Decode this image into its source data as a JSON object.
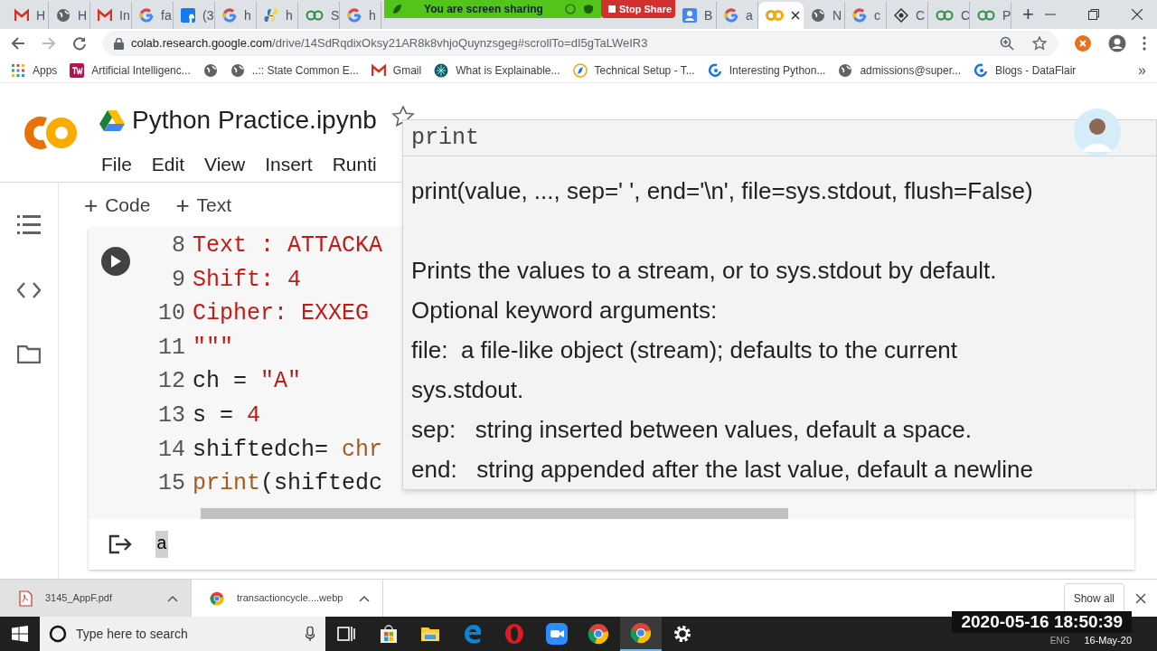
{
  "browser": {
    "tabs_left": [
      {
        "kind": "mail",
        "label": "H",
        "selected": false
      },
      {
        "kind": "globe",
        "label": "H",
        "selected": false
      },
      {
        "kind": "mail",
        "label": "In",
        "selected": false
      },
      {
        "kind": "ring",
        "label": "fa",
        "selected": false
      },
      {
        "kind": "square",
        "label": "(3",
        "selected": false
      },
      {
        "kind": "ring",
        "label": "h",
        "selected": false
      },
      {
        "kind": "twotone",
        "label": "h",
        "selected": false
      },
      {
        "kind": "double",
        "label": "S",
        "selected": false
      },
      {
        "kind": "ring",
        "label": "h",
        "selected": false
      }
    ],
    "sharing_banner": "You are screen sharing",
    "stop_share": "Stop Share",
    "tabs_right": [
      {
        "kind": "person",
        "label": "B",
        "selected": false
      },
      {
        "kind": "ring",
        "label": "a",
        "selected": false
      },
      {
        "kind": "colab",
        "selected": true
      },
      {
        "kind": "globe",
        "label": "N",
        "selected": false
      },
      {
        "kind": "ring",
        "label": "c",
        "selected": false
      },
      {
        "kind": "diamond",
        "label": "C",
        "selected": false
      },
      {
        "kind": "double",
        "label": "C",
        "selected": false
      },
      {
        "kind": "double",
        "label": "P",
        "selected": false
      }
    ],
    "new_tab": "+",
    "url_domain": "colab.research.google.com",
    "url_path": "/drive/14SdRqdixOksy21AR8k8vhjoQuynzsgeg#scrollTo=dI5gTaLWeIR3",
    "bookmarks": [
      {
        "kind": "apps",
        "label": "Apps"
      },
      {
        "kind": "tw",
        "label": "Artificial Intelligenc..."
      },
      {
        "kind": "globe"
      },
      {
        "kind": "globe",
        "label": "..:: State Common E..."
      },
      {
        "kind": "mail",
        "label": "Gmail"
      },
      {
        "kind": "teal",
        "label": "What is Explainable..."
      },
      {
        "kind": "compass",
        "label": "Technical Setup - T..."
      },
      {
        "kind": "flair",
        "label": "Interesting Python..."
      },
      {
        "kind": "globe",
        "label": "admissions@super..."
      },
      {
        "kind": "flair",
        "label": "Blogs - DataFlair"
      }
    ],
    "more_bookmarks": "»"
  },
  "notebook": {
    "title": "Python Practice.ipynb",
    "menu": [
      "File",
      "Edit",
      "View",
      "Insert",
      "Runti"
    ],
    "toolbar": [
      {
        "plus": "+",
        "label": "Code"
      },
      {
        "plus": "+",
        "label": "Text"
      }
    ],
    "code_lines": [
      {
        "number": "8",
        "tokens": [
          {
            "kind": "string",
            "text": "Text : ATTACKA"
          }
        ]
      },
      {
        "number": "9",
        "tokens": [
          {
            "kind": "string",
            "text": "Shift: 4"
          }
        ]
      },
      {
        "number": "10",
        "tokens": [
          {
            "kind": "string",
            "text": "Cipher: EXXEG"
          }
        ]
      },
      {
        "number": "11",
        "tokens": [
          {
            "kind": "string",
            "text": "\"\"\""
          }
        ]
      },
      {
        "number": "12",
        "tokens": [
          {
            "kind": "plain",
            "text": "ch = "
          },
          {
            "kind": "string",
            "text": "\"A\""
          }
        ]
      },
      {
        "number": "13",
        "tokens": [
          {
            "kind": "plain",
            "text": "s = "
          },
          {
            "kind": "number",
            "text": "4"
          }
        ]
      },
      {
        "number": "14",
        "tokens": [
          {
            "kind": "plain",
            "text": "shiftedch= "
          },
          {
            "kind": "builtin",
            "text": "chr"
          }
        ]
      },
      {
        "number": "15",
        "tokens": [
          {
            "kind": "builtin",
            "text": "print"
          },
          {
            "kind": "plain",
            "text": "(shiftedc"
          }
        ]
      }
    ],
    "output": "a",
    "tooltip": {
      "title": "print",
      "signature": "print(value, ..., sep=' ', end='\\n', file=sys.stdout, flush=False)",
      "lines": [
        "Prints the values to a stream, or to sys.stdout by default.",
        "Optional keyword arguments:",
        "file:  a file-like object (stream); defaults to the current",
        "sys.stdout.",
        "sep:   string inserted between values, default a space.",
        "end:   string appended after the last value, default a newline"
      ]
    }
  },
  "downloads": {
    "items": [
      {
        "kind": "pdf",
        "name": "3145_AppF.pdf",
        "selected": true
      },
      {
        "kind": "chrome",
        "name": "transactioncycle....webp",
        "selected": false
      }
    ],
    "show_all": "Show all"
  },
  "taskbar": {
    "search_placeholder": "Type here to search",
    "apps": [
      {
        "kind": "taskview",
        "selected": false
      },
      {
        "kind": "store",
        "selected": false
      },
      {
        "kind": "folder",
        "selected": false
      },
      {
        "kind": "edge",
        "selected": false
      },
      {
        "kind": "opera",
        "selected": false
      },
      {
        "kind": "video",
        "selected": false
      },
      {
        "kind": "chrome",
        "selected": false
      },
      {
        "kind": "chrome",
        "selected": true
      },
      {
        "kind": "gear",
        "selected": false
      }
    ],
    "clock_overlay": "2020-05-16 18:50:39",
    "language": "ENG",
    "date": "16-May-20"
  }
}
